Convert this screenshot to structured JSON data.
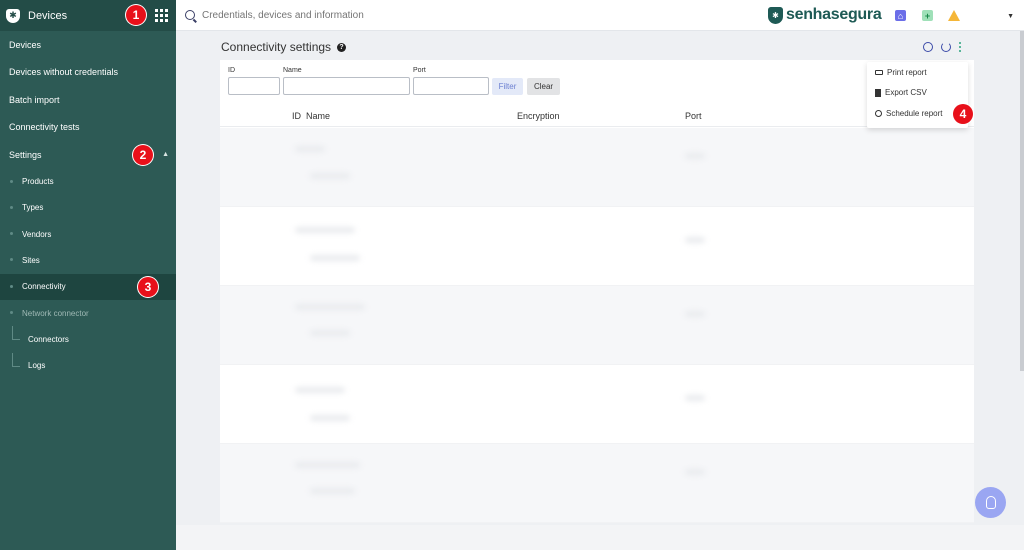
{
  "sidebar": {
    "title": "Devices",
    "items": [
      {
        "label": "Devices"
      },
      {
        "label": "Devices without credentials"
      },
      {
        "label": "Batch import"
      },
      {
        "label": "Connectivity tests"
      },
      {
        "label": "Settings"
      }
    ],
    "settings_children": [
      {
        "label": "Products"
      },
      {
        "label": "Types"
      },
      {
        "label": "Vendors"
      },
      {
        "label": "Sites"
      },
      {
        "label": "Connectivity"
      },
      {
        "label": "Network connector"
      }
    ],
    "network_children": [
      {
        "label": "Connectors"
      },
      {
        "label": "Logs"
      }
    ]
  },
  "topbar": {
    "search_placeholder": "Credentials, devices and information",
    "brand": "senhasegura"
  },
  "main": {
    "title": "Connectivity settings",
    "filters": {
      "id_label": "ID",
      "name_label": "Name",
      "port_label": "Port",
      "filter_button": "Filter",
      "clear_button": "Clear"
    },
    "columns": [
      "ID",
      "Name",
      "Encryption",
      "Port"
    ],
    "menu": [
      {
        "label": "Print report"
      },
      {
        "label": "Export CSV"
      },
      {
        "label": "Schedule report"
      }
    ]
  },
  "annotations": [
    "1",
    "2",
    "3",
    "4"
  ],
  "colors": {
    "sidebar": "#2d5a55",
    "sidebar_header": "#234c47",
    "badge": "#e8101a",
    "accent": "#3b4aa8"
  }
}
